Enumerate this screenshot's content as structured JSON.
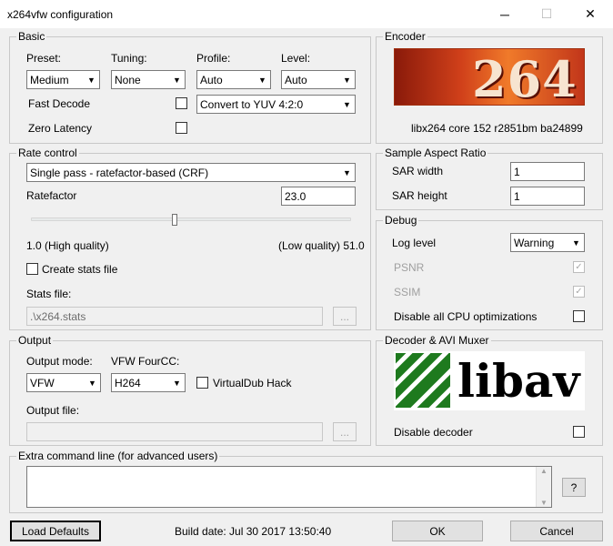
{
  "window": {
    "title": "x264vfw configuration"
  },
  "basic": {
    "title": "Basic",
    "preset_label": "Preset:",
    "preset_value": "Medium",
    "tuning_label": "Tuning:",
    "tuning_value": "None",
    "profile_label": "Profile:",
    "profile_value": "Auto",
    "level_label": "Level:",
    "level_value": "Auto",
    "fast_decode": "Fast Decode",
    "zero_latency": "Zero Latency",
    "convert_value": "Convert to YUV 4:2:0"
  },
  "encoder": {
    "title": "Encoder",
    "logo_text": "264",
    "version": "libx264 core 152 r2851bm ba24899"
  },
  "rate_control": {
    "title": "Rate control",
    "mode_value": "Single pass - ratefactor-based (CRF)",
    "ratefactor_label": "Ratefactor",
    "ratefactor_value": "23.0",
    "slider_fraction": 0.45,
    "low_label": "1.0 (High quality)",
    "high_label": "(Low quality) 51.0",
    "stats_checkbox": "Create stats file",
    "stats_file_label": "Stats file:",
    "stats_file_value": ".\\x264.stats",
    "browse": "..."
  },
  "sar": {
    "title": "Sample Aspect Ratio",
    "width_label": "SAR width",
    "width_value": "1",
    "height_label": "SAR height",
    "height_value": "1"
  },
  "debug": {
    "title": "Debug",
    "log_level_label": "Log level",
    "log_level_value": "Warning",
    "psnr": "PSNR",
    "ssim": "SSIM",
    "disable_cpu": "Disable all CPU optimizations"
  },
  "output": {
    "title": "Output",
    "mode_label": "Output mode:",
    "mode_value": "VFW",
    "fourcc_label": "VFW FourCC:",
    "fourcc_value": "H264",
    "vdub_hack": "VirtualDub Hack",
    "file_label": "Output file:",
    "browse": "..."
  },
  "decoder": {
    "title": "Decoder & AVI Muxer",
    "logo_text": "libav",
    "disable_decoder": "Disable decoder"
  },
  "extra": {
    "title": "Extra command line (for advanced users)",
    "help": "?"
  },
  "footer": {
    "load_defaults": "Load Defaults",
    "build_date": "Build date: Jul 30 2017 13:50:40",
    "ok": "OK",
    "cancel": "Cancel"
  },
  "icons": {
    "close": "✕",
    "minimize": "─",
    "maximize": "☐",
    "arrow": "▼",
    "check": "✓"
  }
}
